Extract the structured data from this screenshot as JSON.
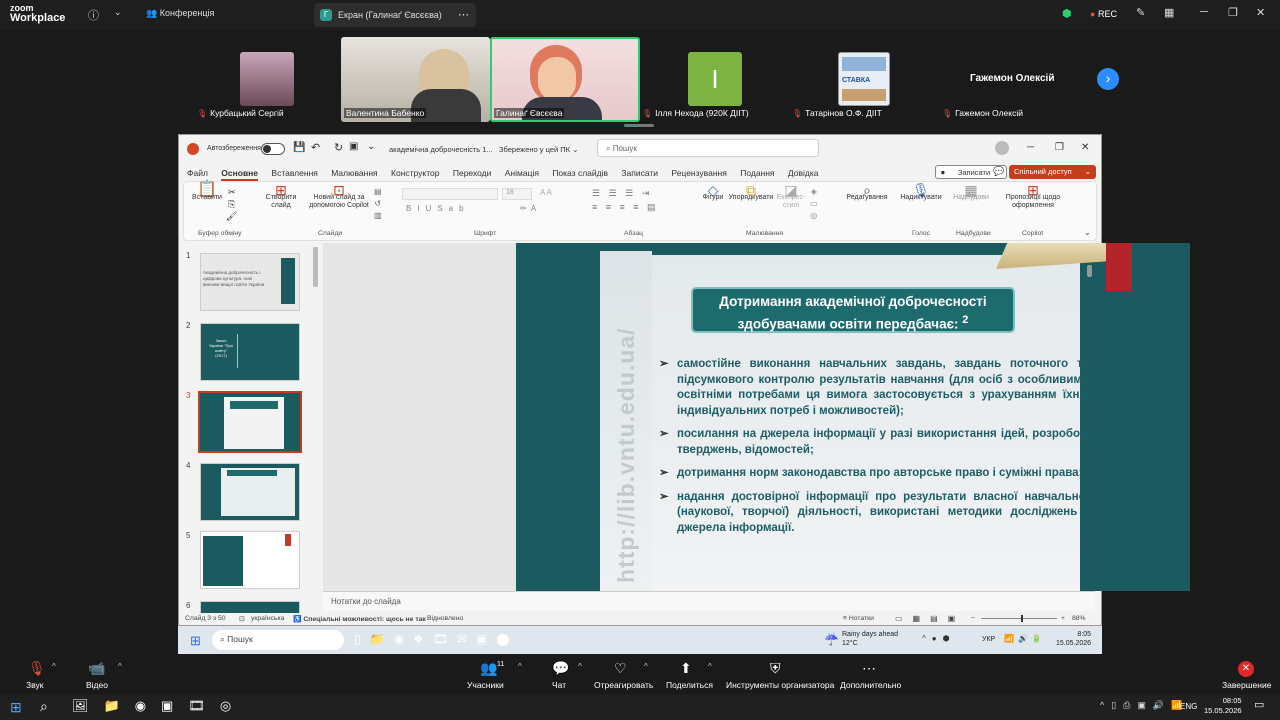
{
  "zoom": {
    "logo_line1": "zoom",
    "logo_line2": "Workplace",
    "meeting_tab": "Конференція",
    "screen_tab": "Екран (Галинаґ Євсєєва)",
    "rec": "REC"
  },
  "participants": [
    {
      "name": "Курбацький Сергій"
    },
    {
      "name": "Валентина Бабенко"
    },
    {
      "name": "Галинаґ Євсєєва"
    },
    {
      "name": "Ілля Нехода (920К ДІІТ)",
      "initial": "І"
    },
    {
      "name": "Татарінов О.Ф. ДІІТ",
      "tile_text": "СТАВКА"
    },
    {
      "name": "Гажемон Олексій",
      "tile_name": "Гажемон Олексій"
    }
  ],
  "ppt": {
    "autosave": "Автозбереження",
    "filename": "академічна доброчесність 1...",
    "saved": "Збережено у цей ПК",
    "search": "Пошук",
    "menu": [
      "Файл",
      "Основне",
      "Вставлення",
      "Малювання",
      "Конструктор",
      "Переходи",
      "Анімація",
      "Показ слайдів",
      "Записати",
      "Рецензування",
      "Подання",
      "Довідка"
    ],
    "record_btn": "Записати",
    "share_btn": "Спільний доступ",
    "ribbon": {
      "paste": "Вставити",
      "clipboard": "Буфер обміну",
      "new_slide": "Створити слайд",
      "new_slide_copilot": "Новий слайд за допомогою Copilot",
      "slides": "Слайди",
      "font": "Шрифт",
      "font_size": "18",
      "paragraph": "Абзац",
      "shapes": "Фігури",
      "arrange": "Упорядкувати",
      "express": "Експрес-стилі",
      "drawing": "Малювання",
      "editing": "Редагування",
      "dictate": "Надиктувати",
      "voice": "Голос",
      "addins": "Надбудови",
      "addins_grp": "Надбудови",
      "designer": "Пропозиції щодо оформлення",
      "copilot": "Copilot"
    },
    "thumb_numbers": [
      "1",
      "2",
      "3",
      "4",
      "5",
      "6"
    ],
    "thumb1_text": "Академічна доброчесність і цифрова культура: нові виклики вищої освіти України",
    "thumb2_text": "Закон України \"Про освіту\" (2017)",
    "slide": {
      "title_line1": "Дотримання академічної доброчесності",
      "title_line2": "здобувачами освіти передбачає:",
      "title_num": "2",
      "watermark": "http://lib.vntu.edu.ua/",
      "bullets": [
        "самостійне виконання навчальних завдань, завдань поточного та підсумкового контролю результатів навчання (для осіб з особливими освітніми потребами ця вимога застосовується з урахуванням їхніх індивідуальних потреб і можливостей);",
        "посилання на джерела інформації у разі використання ідей, розробок, тверджень, відомостей;",
        "дотримання норм законодавства про авторське право і суміжні права;",
        "надання достовірної інформації про результати власної навчальної (наукової, творчої) діяльності, використані методики досліджень і джерела інформації."
      ]
    },
    "notes": "Нотатки до слайда",
    "status": {
      "slide": "Слайд 3 з 50",
      "lang": "українська",
      "access": "Спеціальні можливості: щось не так",
      "ready": "Відновлено",
      "notes_btn": "Нотатки",
      "zoom": "88%"
    }
  },
  "remote_taskbar": {
    "search": "Пошук",
    "weather": "Rainy days ahead",
    "temp": "12°C",
    "lang": "УКР",
    "time": "8:05",
    "date": "15.05.2026"
  },
  "controls": {
    "audio": "Звук",
    "video": "Відео",
    "participants": "Учасники",
    "count": "11",
    "chat": "Чат",
    "react": "Отреагировать",
    "share": "Поделиться",
    "host": "Инструменты организатора",
    "more": "Дополнительно",
    "end": "Завершение"
  },
  "local_taskbar": {
    "lang": "ENG",
    "time": "08:05",
    "date": "15.05.2026"
  }
}
